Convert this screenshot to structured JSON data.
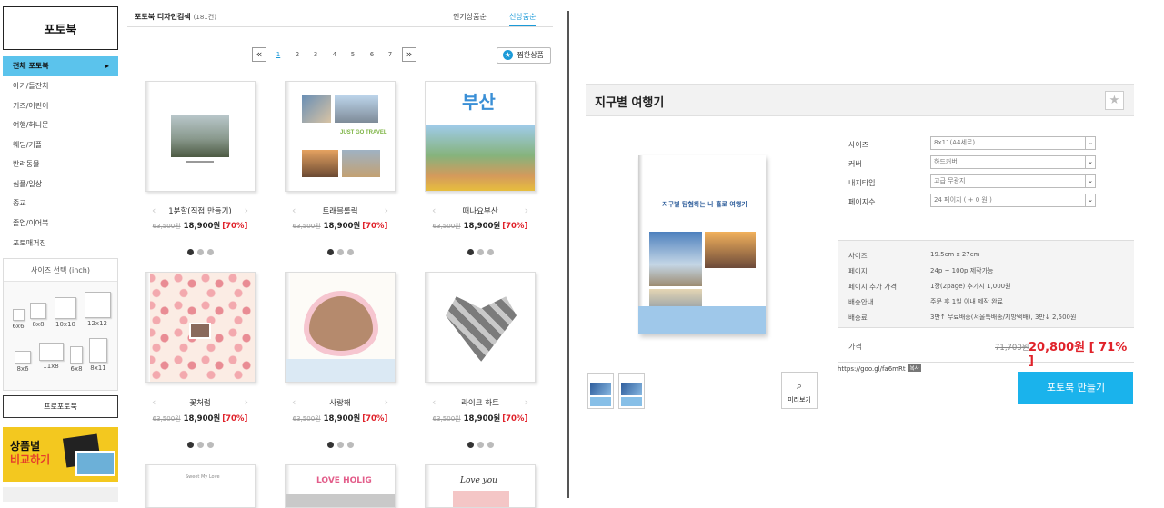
{
  "sidebar": {
    "brand": "포토북",
    "categories": [
      "전체 포토북",
      "아기/돌잔치",
      "키즈/어린이",
      "여행/허니문",
      "웨딩/커플",
      "반려동물",
      "심플/일상",
      "종교",
      "졸업/이어북",
      "포토매거진"
    ],
    "size_title": "사이즈 선택 (inch)",
    "sizes": [
      "6x6",
      "8x8",
      "10x10",
      "12x12",
      "8x6",
      "11x8",
      "6x8",
      "8x11"
    ],
    "pro_link": "프로포토북",
    "compare_banner": {
      "line1": "상품별",
      "line2": "비교하기"
    }
  },
  "main": {
    "title": "포토북 디자인검색",
    "count": "(181건)",
    "sort_tabs": [
      "인기상품순",
      "신상품순"
    ],
    "pages": [
      "1",
      "2",
      "3",
      "4",
      "5",
      "6",
      "7"
    ],
    "pager_prev": "«",
    "pager_next": "»",
    "recommend_btn": "찜한상품",
    "products": [
      {
        "name": "1분할(직접 만들기)",
        "old": "63,500원",
        "new": "18,900원",
        "pct": "[70%]"
      },
      {
        "name": "트래블롤릭",
        "old": "63,500원",
        "new": "18,900원",
        "pct": "[70%]"
      },
      {
        "name": "떠나요부산",
        "old": "63,500원",
        "new": "18,900원",
        "pct": "[70%]"
      },
      {
        "name": "꽃처럼",
        "old": "63,500원",
        "new": "18,900원",
        "pct": "[70%]"
      },
      {
        "name": "사랑해",
        "old": "63,500원",
        "new": "18,900원",
        "pct": "[70%]"
      },
      {
        "name": "라이크 하트",
        "old": "63,500원",
        "new": "18,900원",
        "pct": "[70%]"
      }
    ],
    "cover_texts": {
      "travel": "JUST GO TRAVEL",
      "busan": "부산",
      "love": "LOVE HOLIG",
      "loveyou": "Love you",
      "sweet": "Sweet My Love"
    }
  },
  "detail": {
    "title": "지구별 여행기",
    "cover_text": "지구별 탐험하는 나 홀로 여행기",
    "preview_btn": "미리보기",
    "options": [
      {
        "label": "사이즈",
        "value": "8x11(A4세로)"
      },
      {
        "label": "커버",
        "value": "하드커버"
      },
      {
        "label": "내지타입",
        "value": "고급 무광지"
      },
      {
        "label": "페이지수",
        "value": "24 페이지 ( + 0 원 )"
      }
    ],
    "specs": [
      {
        "k": "사이즈",
        "v": "19.5cm x 27cm"
      },
      {
        "k": "페이지",
        "v": "24p ~ 100p 제작가능"
      },
      {
        "k": "페이지 추가 가격",
        "v": "1장(2page) 추가시 1,000원"
      },
      {
        "k": "배송안내",
        "v": "주문 후 1일 이내 제작 완료"
      },
      {
        "k": "배송료",
        "v": "3만↑ 무료배송(서울특배송/지방택배), 3만↓ 2,500원"
      }
    ],
    "price_label": "가격",
    "price_old": "71,700원",
    "price_new": "20,800원 [ 71% ]",
    "url": "https://goo.gl/fa6mRt",
    "url_badge": "복사",
    "make_btn": "포토북 만들기"
  },
  "colors": {
    "accent": "#1ab3ec",
    "active_cat": "#5bc3ec",
    "sale": "#e0222a"
  }
}
